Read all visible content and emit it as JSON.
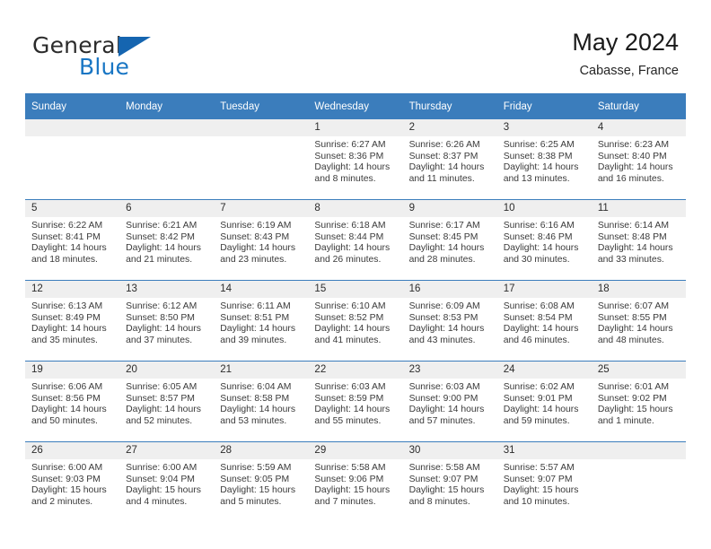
{
  "brand": {
    "name_part1": "General",
    "name_part2": "Blue",
    "logo_icon": "triangle-logo-icon"
  },
  "header": {
    "title": "May 2024",
    "subtitle": "Cabasse, France"
  },
  "colors": {
    "header_blue": "#3b7dbc",
    "brand_blue": "#1976c4",
    "daynum_band": "#efefef",
    "text": "#3a3a3a"
  },
  "calendar": {
    "weekday_headers": [
      "Sunday",
      "Monday",
      "Tuesday",
      "Wednesday",
      "Thursday",
      "Friday",
      "Saturday"
    ],
    "weeks": [
      [
        {
          "day": "",
          "blank": true,
          "sunrise": "",
          "sunset": "",
          "daylight_line1": "",
          "daylight_line2": ""
        },
        {
          "day": "",
          "blank": true,
          "sunrise": "",
          "sunset": "",
          "daylight_line1": "",
          "daylight_line2": ""
        },
        {
          "day": "",
          "blank": true,
          "sunrise": "",
          "sunset": "",
          "daylight_line1": "",
          "daylight_line2": ""
        },
        {
          "day": "1",
          "blank": false,
          "sunrise": "Sunrise: 6:27 AM",
          "sunset": "Sunset: 8:36 PM",
          "daylight_line1": "Daylight: 14 hours",
          "daylight_line2": "and 8 minutes."
        },
        {
          "day": "2",
          "blank": false,
          "sunrise": "Sunrise: 6:26 AM",
          "sunset": "Sunset: 8:37 PM",
          "daylight_line1": "Daylight: 14 hours",
          "daylight_line2": "and 11 minutes."
        },
        {
          "day": "3",
          "blank": false,
          "sunrise": "Sunrise: 6:25 AM",
          "sunset": "Sunset: 8:38 PM",
          "daylight_line1": "Daylight: 14 hours",
          "daylight_line2": "and 13 minutes."
        },
        {
          "day": "4",
          "blank": false,
          "sunrise": "Sunrise: 6:23 AM",
          "sunset": "Sunset: 8:40 PM",
          "daylight_line1": "Daylight: 14 hours",
          "daylight_line2": "and 16 minutes."
        }
      ],
      [
        {
          "day": "5",
          "blank": false,
          "sunrise": "Sunrise: 6:22 AM",
          "sunset": "Sunset: 8:41 PM",
          "daylight_line1": "Daylight: 14 hours",
          "daylight_line2": "and 18 minutes."
        },
        {
          "day": "6",
          "blank": false,
          "sunrise": "Sunrise: 6:21 AM",
          "sunset": "Sunset: 8:42 PM",
          "daylight_line1": "Daylight: 14 hours",
          "daylight_line2": "and 21 minutes."
        },
        {
          "day": "7",
          "blank": false,
          "sunrise": "Sunrise: 6:19 AM",
          "sunset": "Sunset: 8:43 PM",
          "daylight_line1": "Daylight: 14 hours",
          "daylight_line2": "and 23 minutes."
        },
        {
          "day": "8",
          "blank": false,
          "sunrise": "Sunrise: 6:18 AM",
          "sunset": "Sunset: 8:44 PM",
          "daylight_line1": "Daylight: 14 hours",
          "daylight_line2": "and 26 minutes."
        },
        {
          "day": "9",
          "blank": false,
          "sunrise": "Sunrise: 6:17 AM",
          "sunset": "Sunset: 8:45 PM",
          "daylight_line1": "Daylight: 14 hours",
          "daylight_line2": "and 28 minutes."
        },
        {
          "day": "10",
          "blank": false,
          "sunrise": "Sunrise: 6:16 AM",
          "sunset": "Sunset: 8:46 PM",
          "daylight_line1": "Daylight: 14 hours",
          "daylight_line2": "and 30 minutes."
        },
        {
          "day": "11",
          "blank": false,
          "sunrise": "Sunrise: 6:14 AM",
          "sunset": "Sunset: 8:48 PM",
          "daylight_line1": "Daylight: 14 hours",
          "daylight_line2": "and 33 minutes."
        }
      ],
      [
        {
          "day": "12",
          "blank": false,
          "sunrise": "Sunrise: 6:13 AM",
          "sunset": "Sunset: 8:49 PM",
          "daylight_line1": "Daylight: 14 hours",
          "daylight_line2": "and 35 minutes."
        },
        {
          "day": "13",
          "blank": false,
          "sunrise": "Sunrise: 6:12 AM",
          "sunset": "Sunset: 8:50 PM",
          "daylight_line1": "Daylight: 14 hours",
          "daylight_line2": "and 37 minutes."
        },
        {
          "day": "14",
          "blank": false,
          "sunrise": "Sunrise: 6:11 AM",
          "sunset": "Sunset: 8:51 PM",
          "daylight_line1": "Daylight: 14 hours",
          "daylight_line2": "and 39 minutes."
        },
        {
          "day": "15",
          "blank": false,
          "sunrise": "Sunrise: 6:10 AM",
          "sunset": "Sunset: 8:52 PM",
          "daylight_line1": "Daylight: 14 hours",
          "daylight_line2": "and 41 minutes."
        },
        {
          "day": "16",
          "blank": false,
          "sunrise": "Sunrise: 6:09 AM",
          "sunset": "Sunset: 8:53 PM",
          "daylight_line1": "Daylight: 14 hours",
          "daylight_line2": "and 43 minutes."
        },
        {
          "day": "17",
          "blank": false,
          "sunrise": "Sunrise: 6:08 AM",
          "sunset": "Sunset: 8:54 PM",
          "daylight_line1": "Daylight: 14 hours",
          "daylight_line2": "and 46 minutes."
        },
        {
          "day": "18",
          "blank": false,
          "sunrise": "Sunrise: 6:07 AM",
          "sunset": "Sunset: 8:55 PM",
          "daylight_line1": "Daylight: 14 hours",
          "daylight_line2": "and 48 minutes."
        }
      ],
      [
        {
          "day": "19",
          "blank": false,
          "sunrise": "Sunrise: 6:06 AM",
          "sunset": "Sunset: 8:56 PM",
          "daylight_line1": "Daylight: 14 hours",
          "daylight_line2": "and 50 minutes."
        },
        {
          "day": "20",
          "blank": false,
          "sunrise": "Sunrise: 6:05 AM",
          "sunset": "Sunset: 8:57 PM",
          "daylight_line1": "Daylight: 14 hours",
          "daylight_line2": "and 52 minutes."
        },
        {
          "day": "21",
          "blank": false,
          "sunrise": "Sunrise: 6:04 AM",
          "sunset": "Sunset: 8:58 PM",
          "daylight_line1": "Daylight: 14 hours",
          "daylight_line2": "and 53 minutes."
        },
        {
          "day": "22",
          "blank": false,
          "sunrise": "Sunrise: 6:03 AM",
          "sunset": "Sunset: 8:59 PM",
          "daylight_line1": "Daylight: 14 hours",
          "daylight_line2": "and 55 minutes."
        },
        {
          "day": "23",
          "blank": false,
          "sunrise": "Sunrise: 6:03 AM",
          "sunset": "Sunset: 9:00 PM",
          "daylight_line1": "Daylight: 14 hours",
          "daylight_line2": "and 57 minutes."
        },
        {
          "day": "24",
          "blank": false,
          "sunrise": "Sunrise: 6:02 AM",
          "sunset": "Sunset: 9:01 PM",
          "daylight_line1": "Daylight: 14 hours",
          "daylight_line2": "and 59 minutes."
        },
        {
          "day": "25",
          "blank": false,
          "sunrise": "Sunrise: 6:01 AM",
          "sunset": "Sunset: 9:02 PM",
          "daylight_line1": "Daylight: 15 hours",
          "daylight_line2": "and 1 minute."
        }
      ],
      [
        {
          "day": "26",
          "blank": false,
          "sunrise": "Sunrise: 6:00 AM",
          "sunset": "Sunset: 9:03 PM",
          "daylight_line1": "Daylight: 15 hours",
          "daylight_line2": "and 2 minutes."
        },
        {
          "day": "27",
          "blank": false,
          "sunrise": "Sunrise: 6:00 AM",
          "sunset": "Sunset: 9:04 PM",
          "daylight_line1": "Daylight: 15 hours",
          "daylight_line2": "and 4 minutes."
        },
        {
          "day": "28",
          "blank": false,
          "sunrise": "Sunrise: 5:59 AM",
          "sunset": "Sunset: 9:05 PM",
          "daylight_line1": "Daylight: 15 hours",
          "daylight_line2": "and 5 minutes."
        },
        {
          "day": "29",
          "blank": false,
          "sunrise": "Sunrise: 5:58 AM",
          "sunset": "Sunset: 9:06 PM",
          "daylight_line1": "Daylight: 15 hours",
          "daylight_line2": "and 7 minutes."
        },
        {
          "day": "30",
          "blank": false,
          "sunrise": "Sunrise: 5:58 AM",
          "sunset": "Sunset: 9:07 PM",
          "daylight_line1": "Daylight: 15 hours",
          "daylight_line2": "and 8 minutes."
        },
        {
          "day": "31",
          "blank": false,
          "sunrise": "Sunrise: 5:57 AM",
          "sunset": "Sunset: 9:07 PM",
          "daylight_line1": "Daylight: 15 hours",
          "daylight_line2": "and 10 minutes."
        },
        {
          "day": "",
          "blank": true,
          "sunrise": "",
          "sunset": "",
          "daylight_line1": "",
          "daylight_line2": ""
        }
      ]
    ]
  }
}
